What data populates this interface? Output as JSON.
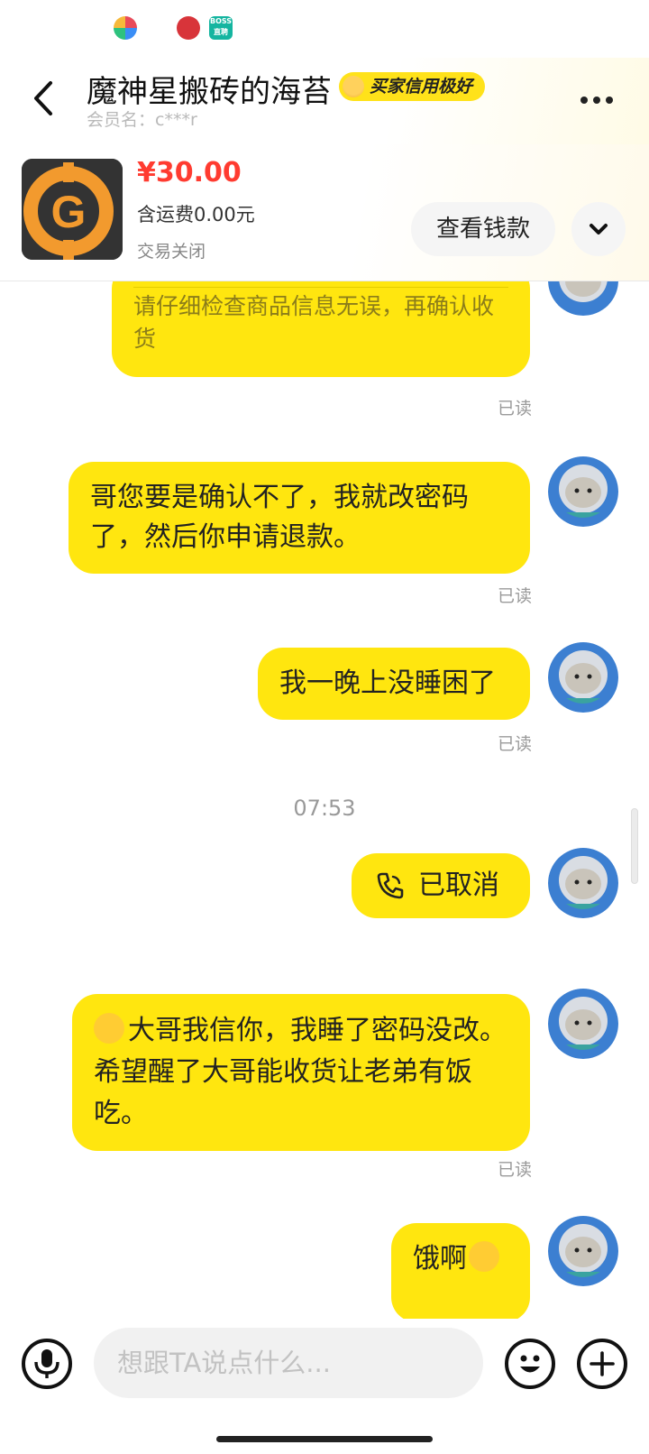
{
  "header": {
    "title": "魔神星搬砖的海苔",
    "credit_badge": "买家信用极好",
    "member_label": "会员名：c***r"
  },
  "item": {
    "price": "¥30.00",
    "shipping": "含运费0.00元",
    "status": "交易关闭",
    "view_button": "查看钱款"
  },
  "messages": [
    {
      "type": "sent",
      "text": "请仔细检查商品信息无误，再确认收货",
      "read": "已读",
      "faded": true
    },
    {
      "type": "sent",
      "text": "哥您要是确认不了，我就改密码了，然后你申请退款。",
      "read": "已读"
    },
    {
      "type": "sent",
      "text": "我一晚上没睡困了",
      "read": "已读"
    },
    {
      "type": "time",
      "text": "07:53"
    },
    {
      "type": "call",
      "text": "已取消"
    },
    {
      "type": "sent",
      "text": "大哥我信你，我睡了密码没改。希望醒了大哥能收货让老弟有饭吃。",
      "read": "已读"
    },
    {
      "type": "sent",
      "text": "饿啊"
    }
  ],
  "input": {
    "placeholder": "想跟TA说点什么..."
  },
  "colors": {
    "bubble": "#ffe60f",
    "price": "#ff3b30",
    "badge": "#ffe21a"
  }
}
